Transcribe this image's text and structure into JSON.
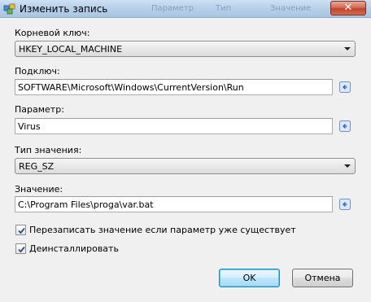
{
  "window": {
    "title": "Изменить запись",
    "close_label": "✕",
    "background_menu": [
      "Параметр",
      "Тип",
      "Значение"
    ]
  },
  "form": {
    "root_key": {
      "label": "Корневой ключ:",
      "value": "HKEY_LOCAL_MACHINE"
    },
    "subkey": {
      "label": "Подключ:",
      "value": "SOFTWARE\\Microsoft\\Windows\\CurrentVersion\\Run"
    },
    "parameter": {
      "label": "Параметр:",
      "value": "Virus"
    },
    "value_type": {
      "label": "Тип значения:",
      "value": "REG_SZ"
    },
    "value": {
      "label": "Значение:",
      "value": "C:\\Program Files\\proga\\var.bat"
    }
  },
  "options": {
    "overwrite": {
      "label": "Перезаписать значение если параметр уже существует",
      "checked": true
    },
    "uninstall": {
      "label": "Деинсталлировать",
      "checked": true
    }
  },
  "buttons": {
    "ok": "OK",
    "cancel": "Отмена"
  },
  "icons": {
    "app": "registry-edit-icon",
    "picker": "browse-icon",
    "check": "checkmark-icon"
  }
}
